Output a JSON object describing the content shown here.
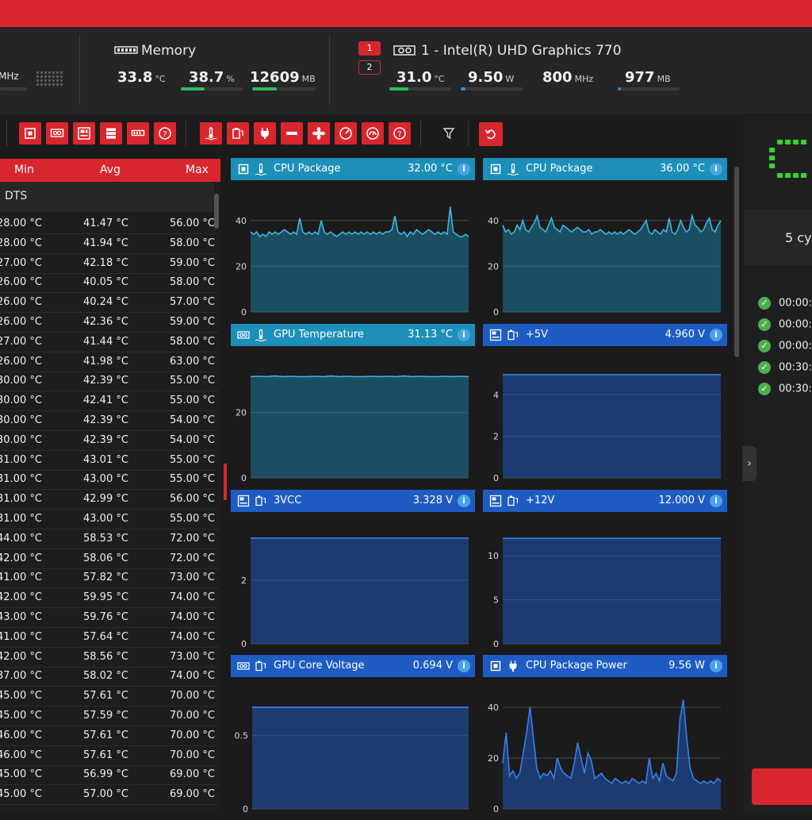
{
  "header": {
    "cpu_unit_fragment": "MHz",
    "memory": {
      "title": "Memory",
      "load": {
        "value": "33.8",
        "unit": "°C"
      },
      "usage": {
        "value": "38.7",
        "unit": "%",
        "fraction": 0.387
      },
      "used": {
        "value": "12609",
        "unit": "MB",
        "fraction": 0.39
      }
    },
    "gpu": {
      "selector": [
        "1",
        "2"
      ],
      "title": "1 - Intel(R) UHD Graphics 770",
      "temp": {
        "value": "31.0",
        "unit": "°C",
        "fraction": 0.31
      },
      "power": {
        "value": "9.50",
        "unit": "W",
        "fraction": 0.08
      },
      "clock": {
        "value": "800",
        "unit": "MHz"
      },
      "memory": {
        "value": "977",
        "unit": "MB",
        "fraction": 0.05
      }
    }
  },
  "toolbar": {
    "icons": [
      "cpu-icon",
      "gpu-icon",
      "motherboard-icon",
      "storage-icon",
      "memory-icon",
      "help-icon",
      "temperature-icon",
      "voltage-icon",
      "power-icon",
      "current-icon",
      "fan-icon",
      "speed-icon",
      "gauge-icon",
      "help-icon",
      "filter-icon",
      "reset-icon"
    ]
  },
  "table": {
    "columns": {
      "min": "Min",
      "avg": "Avg",
      "max": "Max"
    },
    "group": "DTS",
    "rows": [
      [
        "28.00 °C",
        "41.47 °C",
        "56.00 °C"
      ],
      [
        "28.00 °C",
        "41.94 °C",
        "58.00 °C"
      ],
      [
        "27.00 °C",
        "42.18 °C",
        "59.00 °C"
      ],
      [
        "26.00 °C",
        "40.05 °C",
        "58.00 °C"
      ],
      [
        "26.00 °C",
        "40.24 °C",
        "57.00 °C"
      ],
      [
        "26.00 °C",
        "42.36 °C",
        "59.00 °C"
      ],
      [
        "27.00 °C",
        "41.44 °C",
        "58.00 °C"
      ],
      [
        "26.00 °C",
        "41.98 °C",
        "63.00 °C"
      ],
      [
        "30.00 °C",
        "42.39 °C",
        "55.00 °C"
      ],
      [
        "30.00 °C",
        "42.41 °C",
        "55.00 °C"
      ],
      [
        "30.00 °C",
        "42.39 °C",
        "54.00 °C"
      ],
      [
        "30.00 °C",
        "42.39 °C",
        "54.00 °C"
      ],
      [
        "31.00 °C",
        "43.01 °C",
        "55.00 °C"
      ],
      [
        "31.00 °C",
        "43.00 °C",
        "55.00 °C"
      ],
      [
        "31.00 °C",
        "42.99 °C",
        "56.00 °C"
      ],
      [
        "31.00 °C",
        "43.00 °C",
        "55.00 °C"
      ],
      [
        "44.00 °C",
        "58.53 °C",
        "72.00 °C"
      ],
      [
        "42.00 °C",
        "58.06 °C",
        "72.00 °C"
      ],
      [
        "41.00 °C",
        "57.82 °C",
        "73.00 °C"
      ],
      [
        "42.00 °C",
        "59.95 °C",
        "74.00 °C"
      ],
      [
        "43.00 °C",
        "59.76 °C",
        "74.00 °C"
      ],
      [
        "41.00 °C",
        "57.64 °C",
        "74.00 °C"
      ],
      [
        "42.00 °C",
        "58.56 °C",
        "73.00 °C"
      ],
      [
        "37.00 °C",
        "58.02 °C",
        "74.00 °C"
      ],
      [
        "45.00 °C",
        "57.61 °C",
        "70.00 °C"
      ],
      [
        "45.00 °C",
        "57.59 °C",
        "70.00 °C"
      ],
      [
        "46.00 °C",
        "57.61 °C",
        "70.00 °C"
      ],
      [
        "46.00 °C",
        "57.61 °C",
        "70.00 °C"
      ],
      [
        "45.00 °C",
        "56.99 °C",
        "69.00 °C"
      ],
      [
        "45.00 °C",
        "57.00 °C",
        "69.00 °C"
      ]
    ]
  },
  "chart_data": [
    {
      "type": "area",
      "title": "CPU Package",
      "value": "32.00 °C",
      "icon": "temperature-icon",
      "group_icon": "cpu-icon",
      "color": "#1d8fb8",
      "ylim": [
        0,
        50
      ],
      "yticks": [
        "40",
        "20",
        "0"
      ],
      "ytick_values": [
        40,
        20,
        0
      ],
      "values": [
        35,
        34,
        35,
        33,
        34,
        33,
        35,
        34,
        35,
        34,
        35,
        36,
        35,
        34,
        35,
        34,
        41,
        35,
        34,
        35,
        34,
        35,
        34,
        40,
        35,
        34,
        35,
        34,
        33,
        34,
        35,
        34,
        35,
        34,
        35,
        34,
        35,
        34,
        35,
        34,
        35,
        34,
        35,
        34,
        35,
        35,
        36,
        42,
        35,
        34,
        35,
        33,
        35,
        34,
        36,
        35,
        34,
        35,
        36,
        35,
        34,
        35,
        34,
        35,
        34,
        46,
        35,
        34,
        33,
        33,
        34,
        33
      ]
    },
    {
      "type": "area",
      "title": "CPU Package",
      "value": "36.00 °C",
      "icon": "temperature-icon",
      "group_icon": "cpu-icon",
      "color": "#1d8fb8",
      "ylim": [
        0,
        50
      ],
      "yticks": [
        "40",
        "20",
        "0"
      ],
      "ytick_values": [
        40,
        20,
        0
      ],
      "values": [
        38,
        35,
        36,
        34,
        35,
        38,
        36,
        40,
        36,
        35,
        37,
        39,
        42,
        37,
        36,
        35,
        38,
        41,
        37,
        36,
        35,
        38,
        37,
        36,
        35,
        36,
        37,
        36,
        35,
        35,
        36,
        34,
        35,
        35,
        36,
        35,
        34,
        35,
        34,
        35,
        34,
        35,
        34,
        35,
        36,
        35,
        34,
        35,
        36,
        38,
        40,
        35,
        34,
        36,
        35,
        34,
        36,
        35,
        41,
        35,
        34,
        36,
        40,
        37,
        35,
        36,
        42,
        38,
        37,
        35,
        36,
        39,
        41,
        36,
        35,
        38,
        40
      ]
    },
    {
      "type": "area",
      "title": "GPU Temperature",
      "value": "31.13 °C",
      "icon": "temperature-icon",
      "group_icon": "gpu-icon",
      "color": "#1d8fb8",
      "ylim": [
        0,
        35
      ],
      "yticks": [
        "20",
        "0"
      ],
      "ytick_values": [
        20,
        0
      ],
      "values": [
        31.0,
        31.1,
        31.0,
        31.2,
        31.0,
        31.1,
        31.0,
        31.0,
        31.1,
        31.0,
        31.2,
        31.0,
        31.1,
        31.0,
        31.0,
        31.1,
        31.0,
        31.1,
        31.0,
        31.2,
        31.0,
        31.1,
        31.0,
        31.0,
        31.1,
        31.0,
        31.1,
        31.0
      ]
    },
    {
      "type": "area",
      "title": "+5V",
      "value": "4.960 V",
      "icon": "voltage-icon",
      "group_icon": "motherboard-icon",
      "color": "#1e5cc4",
      "ylim": [
        0,
        5.5
      ],
      "yticks": [
        "4",
        "2",
        "0"
      ],
      "ytick_values": [
        4,
        2,
        0
      ],
      "values": [
        4.96,
        4.96,
        4.96,
        4.96,
        4.96,
        4.96,
        4.96,
        4.96
      ]
    },
    {
      "type": "area",
      "title": "3VCC",
      "value": "3.328 V",
      "icon": "voltage-icon",
      "group_icon": "motherboard-icon",
      "color": "#1e5cc4",
      "ylim": [
        0,
        3.6
      ],
      "yticks": [
        "2",
        "0"
      ],
      "ytick_values": [
        2,
        0
      ],
      "values": [
        3.328,
        3.328,
        3.328,
        3.328,
        3.328,
        3.328,
        3.328,
        3.328
      ]
    },
    {
      "type": "area",
      "title": "+12V",
      "value": "12.000 V",
      "icon": "voltage-icon",
      "group_icon": "motherboard-icon",
      "color": "#1e5cc4",
      "ylim": [
        0,
        13
      ],
      "yticks": [
        "10",
        "5",
        "0"
      ],
      "ytick_values": [
        10,
        5,
        0
      ],
      "values": [
        12.0,
        12.0,
        12.0,
        12.0,
        12.0,
        12.0,
        12.0,
        12.0
      ]
    },
    {
      "type": "area",
      "title": "GPU Core Voltage",
      "value": "0.694 V",
      "icon": "voltage-icon",
      "group_icon": "gpu-icon",
      "color": "#1e5cc4",
      "ylim": [
        0,
        0.78
      ],
      "yticks": [
        "0.5",
        "0"
      ],
      "ytick_values": [
        0.5,
        0
      ],
      "values": [
        0.694,
        0.694,
        0.694,
        0.694,
        0.694,
        0.694,
        0.694,
        0.694
      ]
    },
    {
      "type": "area",
      "title": "CPU Package Power",
      "value": "9.56 W",
      "icon": "power-icon",
      "group_icon": "cpu-icon",
      "color": "#1e5cc4",
      "ylim": [
        0,
        45
      ],
      "yticks": [
        "40",
        "20",
        "0"
      ],
      "ytick_values": [
        40,
        20,
        0
      ],
      "values": [
        18,
        30,
        13,
        15,
        12,
        14,
        22,
        30,
        40,
        28,
        16,
        12,
        14,
        13,
        15,
        12,
        20,
        16,
        14,
        13,
        12,
        18,
        26,
        20,
        14,
        22,
        19,
        12,
        13,
        14,
        12,
        11,
        10,
        12,
        11,
        10,
        11,
        10,
        12,
        11,
        10,
        11,
        10,
        20,
        12,
        14,
        11,
        18,
        13,
        12,
        11,
        14,
        35,
        43,
        28,
        16,
        12,
        11,
        10,
        11,
        10,
        11,
        10,
        12,
        11
      ]
    }
  ],
  "right_panel": {
    "cycles_label": "5 cy",
    "log": [
      "00:00:",
      "00:00:",
      "00:00:",
      "00:30:",
      "00:30:"
    ]
  },
  "colors": {
    "accent_red": "#d9262e",
    "bar_green": "#2ebd59",
    "bar_blue": "#2c8ddf",
    "cycle_green": "#39d12a"
  }
}
